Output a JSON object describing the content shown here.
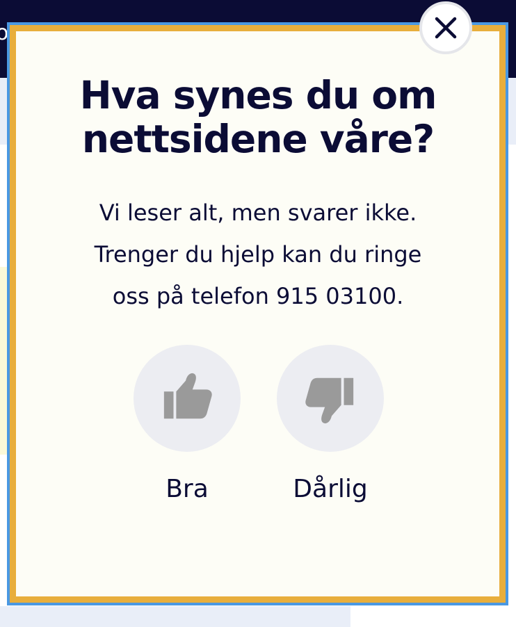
{
  "background": {
    "topbar_text": "o"
  },
  "modal": {
    "title_lines": [
      "Hva synes du om",
      "nettsidene våre?"
    ],
    "description_lines": [
      "Vi leser alt, men svarer ikke.",
      "Trenger du hjelp kan du ringe",
      "oss på telefon 915 03100."
    ],
    "close_icon": "close-icon",
    "vote_good": {
      "label": "Bra",
      "icon": "thumbs-up-icon"
    },
    "vote_bad": {
      "label": "Dårlig",
      "icon": "thumbs-down-icon"
    }
  },
  "colors": {
    "navy": "#0b0c35",
    "modal_background": "#fdfdf6",
    "frame_orange": "#e8ae3c",
    "frame_blue": "#4a98e2",
    "icon_gray": "#9a9a9a",
    "vote_circle": "#ecedf2"
  }
}
